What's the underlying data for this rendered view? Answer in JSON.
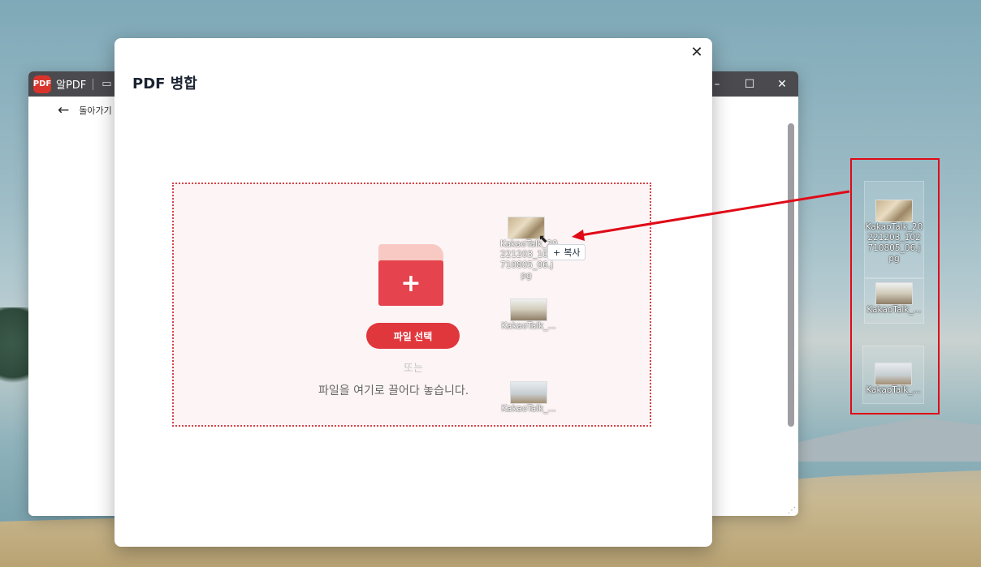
{
  "background_window": {
    "app_name": "알PDF",
    "logo_label": "PDF",
    "back_label": "돌아가기",
    "controls": [
      "–",
      "☐",
      "✕"
    ]
  },
  "modal": {
    "title": "PDF 병합",
    "close_label": "✕",
    "dropzone": {
      "plus": "+",
      "select_button": "파일 선택",
      "or_text": "또는",
      "drag_text": "파일을 여기로 끌어다 놓습니다."
    },
    "dragging_files": [
      {
        "line1": "KakaoTalk_20",
        "line2": "221203_102",
        "line3": "710805_06.j",
        "line4": "pg"
      },
      {
        "label": "KakaoTalk_..."
      },
      {
        "label": "KakaoTalk_..."
      }
    ],
    "copy_tooltip": {
      "icon": "+",
      "label": "복사"
    }
  },
  "desktop_files": [
    {
      "line1": "KakaoTalk_20",
      "line2": "221203_102",
      "line3": "710805_06.j",
      "line4": "pg"
    },
    {
      "label": "KakaoTalk_..."
    },
    {
      "label": "KakaoTalk_..."
    }
  ],
  "colors": {
    "accent_red": "#e0373d",
    "annotation_red": "#e00a17",
    "titlebar": "#4a4a4f"
  },
  "icons": [
    "back-arrow-icon",
    "folder-icon",
    "folder-add-icon",
    "close-icon",
    "minimize-icon",
    "maximize-icon",
    "cursor-icon",
    "copy-plus-icon"
  ]
}
